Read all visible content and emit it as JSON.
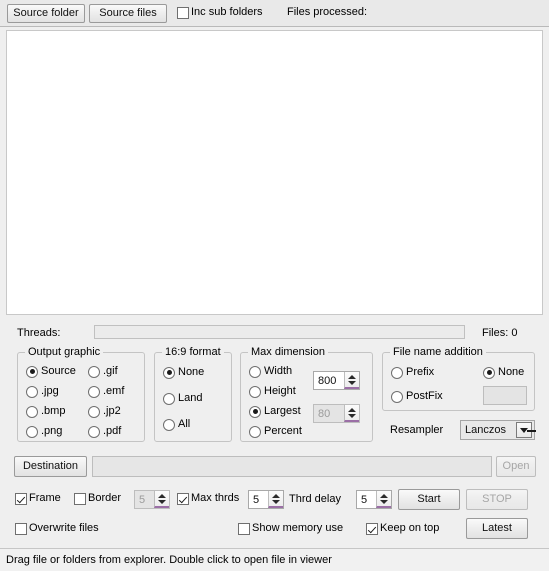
{
  "toolbar": {
    "source_folder_label": "Source folder",
    "source_files_label": "Source files",
    "inc_sub_folders_label": "Inc sub folders",
    "inc_sub_folders_checked": false,
    "files_processed_label": "Files processed:"
  },
  "filelist": {
    "items": []
  },
  "threads": {
    "label": "Threads:",
    "progress_percent": 0,
    "files_count_label": "Files: 0"
  },
  "output_graphic": {
    "legend": "Output graphic",
    "selected": "Source",
    "options": [
      {
        "label": "Source",
        "selected": true
      },
      {
        "label": ".gif",
        "selected": false
      },
      {
        "label": ".jpg",
        "selected": false
      },
      {
        "label": ".emf",
        "selected": false
      },
      {
        "label": ".bmp",
        "selected": false
      },
      {
        "label": ".jp2",
        "selected": false
      },
      {
        "label": ".png",
        "selected": false
      },
      {
        "label": ".pdf",
        "selected": false
      }
    ]
  },
  "format_169": {
    "legend": "16:9 format",
    "selected": "None",
    "options": [
      {
        "label": "None",
        "selected": true
      },
      {
        "label": "Land",
        "selected": false
      },
      {
        "label": "All",
        "selected": false
      }
    ]
  },
  "max_dimension": {
    "legend": "Max dimension",
    "selected": "Largest",
    "options": [
      {
        "label": "Width",
        "selected": false
      },
      {
        "label": "Height",
        "selected": false
      },
      {
        "label": "Largest",
        "selected": true
      },
      {
        "label": "Percent",
        "selected": false
      }
    ],
    "size_value": "800",
    "percent_value": "80",
    "percent_disabled": true
  },
  "file_name_addition": {
    "legend": "File name addition",
    "selected": "None",
    "options": [
      {
        "label": "Prefix",
        "selected": false
      },
      {
        "label": "None",
        "selected": true
      },
      {
        "label": "PostFix",
        "selected": false
      }
    ],
    "postfix_value": "",
    "postfix_disabled": true
  },
  "resampler": {
    "label": "Resampler",
    "value": "Lanczos",
    "options": [
      "Lanczos"
    ]
  },
  "destination": {
    "button_label": "Destination",
    "path_value": "",
    "path_placeholder": "",
    "open_label": "Open",
    "open_disabled": true
  },
  "options_row": {
    "frame_label": "Frame",
    "frame_checked": true,
    "border_label": "Border",
    "border_checked": false,
    "border_value": "5",
    "border_disabled": true,
    "max_thrds_label": "Max thrds",
    "max_thrds_checked": true,
    "max_thrds_value": "5",
    "thrd_delay_label": "Thrd delay",
    "thrd_delay_value": "5",
    "start_label": "Start",
    "stop_label": "STOP",
    "stop_disabled": true
  },
  "bottom_row": {
    "overwrite_label": "Overwrite files",
    "overwrite_checked": false,
    "show_memory_label": "Show memory use",
    "show_memory_checked": false,
    "keep_on_top_label": "Keep on top",
    "keep_on_top_checked": true,
    "latest_label": "Latest"
  },
  "statusbar": {
    "text": "Drag file or folders from explorer.  Double click to open file in viewer"
  }
}
